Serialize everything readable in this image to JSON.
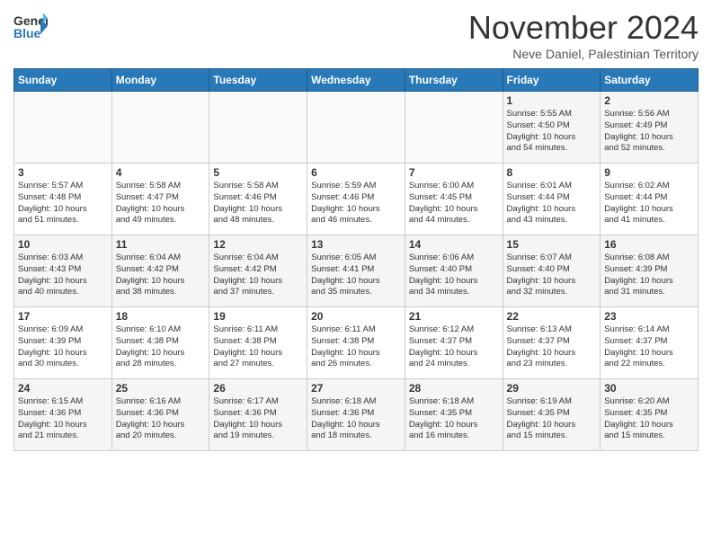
{
  "header": {
    "logo": {
      "general": "General",
      "blue": "Blue",
      "arrow_unicode": "▶"
    },
    "month_title": "November 2024",
    "subtitle": "Neve Daniel, Palestinian Territory"
  },
  "weekdays": [
    "Sunday",
    "Monday",
    "Tuesday",
    "Wednesday",
    "Thursday",
    "Friday",
    "Saturday"
  ],
  "weeks": [
    {
      "days": [
        {
          "number": "",
          "info": ""
        },
        {
          "number": "",
          "info": ""
        },
        {
          "number": "",
          "info": ""
        },
        {
          "number": "",
          "info": ""
        },
        {
          "number": "",
          "info": ""
        },
        {
          "number": "1",
          "info": "Sunrise: 5:55 AM\nSunset: 4:50 PM\nDaylight: 10 hours\nand 54 minutes."
        },
        {
          "number": "2",
          "info": "Sunrise: 5:56 AM\nSunset: 4:49 PM\nDaylight: 10 hours\nand 52 minutes."
        }
      ]
    },
    {
      "days": [
        {
          "number": "3",
          "info": "Sunrise: 5:57 AM\nSunset: 4:48 PM\nDaylight: 10 hours\nand 51 minutes."
        },
        {
          "number": "4",
          "info": "Sunrise: 5:58 AM\nSunset: 4:47 PM\nDaylight: 10 hours\nand 49 minutes."
        },
        {
          "number": "5",
          "info": "Sunrise: 5:58 AM\nSunset: 4:46 PM\nDaylight: 10 hours\nand 48 minutes."
        },
        {
          "number": "6",
          "info": "Sunrise: 5:59 AM\nSunset: 4:46 PM\nDaylight: 10 hours\nand 46 minutes."
        },
        {
          "number": "7",
          "info": "Sunrise: 6:00 AM\nSunset: 4:45 PM\nDaylight: 10 hours\nand 44 minutes."
        },
        {
          "number": "8",
          "info": "Sunrise: 6:01 AM\nSunset: 4:44 PM\nDaylight: 10 hours\nand 43 minutes."
        },
        {
          "number": "9",
          "info": "Sunrise: 6:02 AM\nSunset: 4:44 PM\nDaylight: 10 hours\nand 41 minutes."
        }
      ]
    },
    {
      "days": [
        {
          "number": "10",
          "info": "Sunrise: 6:03 AM\nSunset: 4:43 PM\nDaylight: 10 hours\nand 40 minutes."
        },
        {
          "number": "11",
          "info": "Sunrise: 6:04 AM\nSunset: 4:42 PM\nDaylight: 10 hours\nand 38 minutes."
        },
        {
          "number": "12",
          "info": "Sunrise: 6:04 AM\nSunset: 4:42 PM\nDaylight: 10 hours\nand 37 minutes."
        },
        {
          "number": "13",
          "info": "Sunrise: 6:05 AM\nSunset: 4:41 PM\nDaylight: 10 hours\nand 35 minutes."
        },
        {
          "number": "14",
          "info": "Sunrise: 6:06 AM\nSunset: 4:40 PM\nDaylight: 10 hours\nand 34 minutes."
        },
        {
          "number": "15",
          "info": "Sunrise: 6:07 AM\nSunset: 4:40 PM\nDaylight: 10 hours\nand 32 minutes."
        },
        {
          "number": "16",
          "info": "Sunrise: 6:08 AM\nSunset: 4:39 PM\nDaylight: 10 hours\nand 31 minutes."
        }
      ]
    },
    {
      "days": [
        {
          "number": "17",
          "info": "Sunrise: 6:09 AM\nSunset: 4:39 PM\nDaylight: 10 hours\nand 30 minutes."
        },
        {
          "number": "18",
          "info": "Sunrise: 6:10 AM\nSunset: 4:38 PM\nDaylight: 10 hours\nand 28 minutes."
        },
        {
          "number": "19",
          "info": "Sunrise: 6:11 AM\nSunset: 4:38 PM\nDaylight: 10 hours\nand 27 minutes."
        },
        {
          "number": "20",
          "info": "Sunrise: 6:11 AM\nSunset: 4:38 PM\nDaylight: 10 hours\nand 26 minutes."
        },
        {
          "number": "21",
          "info": "Sunrise: 6:12 AM\nSunset: 4:37 PM\nDaylight: 10 hours\nand 24 minutes."
        },
        {
          "number": "22",
          "info": "Sunrise: 6:13 AM\nSunset: 4:37 PM\nDaylight: 10 hours\nand 23 minutes."
        },
        {
          "number": "23",
          "info": "Sunrise: 6:14 AM\nSunset: 4:37 PM\nDaylight: 10 hours\nand 22 minutes."
        }
      ]
    },
    {
      "days": [
        {
          "number": "24",
          "info": "Sunrise: 6:15 AM\nSunset: 4:36 PM\nDaylight: 10 hours\nand 21 minutes."
        },
        {
          "number": "25",
          "info": "Sunrise: 6:16 AM\nSunset: 4:36 PM\nDaylight: 10 hours\nand 20 minutes."
        },
        {
          "number": "26",
          "info": "Sunrise: 6:17 AM\nSunset: 4:36 PM\nDaylight: 10 hours\nand 19 minutes."
        },
        {
          "number": "27",
          "info": "Sunrise: 6:18 AM\nSunset: 4:36 PM\nDaylight: 10 hours\nand 18 minutes."
        },
        {
          "number": "28",
          "info": "Sunrise: 6:18 AM\nSunset: 4:35 PM\nDaylight: 10 hours\nand 16 minutes."
        },
        {
          "number": "29",
          "info": "Sunrise: 6:19 AM\nSunset: 4:35 PM\nDaylight: 10 hours\nand 15 minutes."
        },
        {
          "number": "30",
          "info": "Sunrise: 6:20 AM\nSunset: 4:35 PM\nDaylight: 10 hours\nand 15 minutes."
        }
      ]
    }
  ]
}
